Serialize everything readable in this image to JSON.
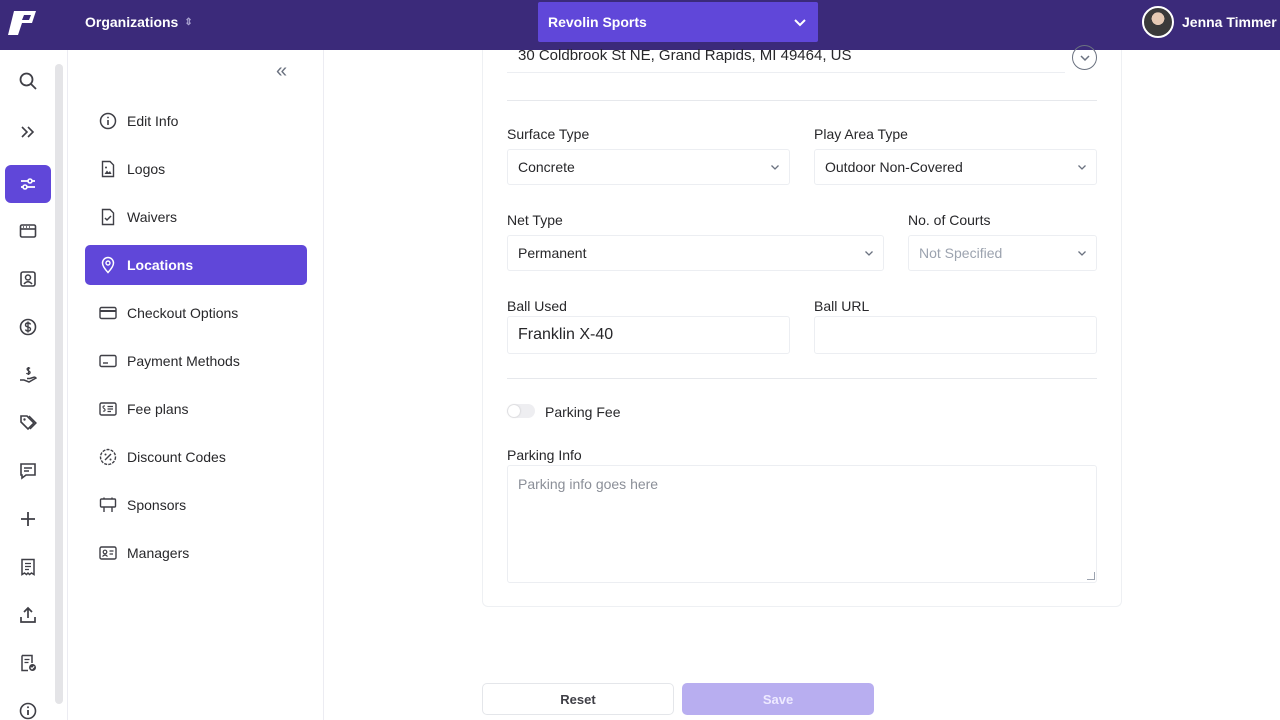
{
  "topbar": {
    "org_label": "Organizations",
    "org_selected": "Revolin Sports",
    "user_name": "Jenna Timmer",
    "colors": {
      "bg": "#3b2a7a",
      "accent": "#6047d9"
    }
  },
  "rail": {
    "icons": [
      "search-icon",
      "expand-icon",
      "settings-sliders-icon",
      "calendar-card-icon",
      "contact-icon",
      "dollar-icon",
      "payout-hand-icon",
      "tags-icon",
      "chat-icon",
      "plus-icon",
      "receipt-icon",
      "upload-icon",
      "checklist-icon",
      "info-icon"
    ]
  },
  "sidebar": {
    "items": [
      {
        "label": "Edit Info",
        "icon": "info-icon"
      },
      {
        "label": "Logos",
        "icon": "image-file-icon"
      },
      {
        "label": "Waivers",
        "icon": "file-check-icon"
      },
      {
        "label": "Locations",
        "icon": "map-pin-icon",
        "active": true
      },
      {
        "label": "Checkout Options",
        "icon": "credit-card-icon"
      },
      {
        "label": "Payment Methods",
        "icon": "payment-card-icon"
      },
      {
        "label": "Fee plans",
        "icon": "fee-list-icon"
      },
      {
        "label": "Discount Codes",
        "icon": "discount-icon"
      },
      {
        "label": "Sponsors",
        "icon": "billboard-icon"
      },
      {
        "label": "Managers",
        "icon": "id-card-icon"
      }
    ]
  },
  "form": {
    "address": "30 Coldbrook St NE, Grand Rapids, MI 49464, US",
    "surface_type": {
      "label": "Surface Type",
      "value": "Concrete"
    },
    "play_area_type": {
      "label": "Play Area Type",
      "value": "Outdoor Non-Covered"
    },
    "net_type": {
      "label": "Net Type",
      "value": "Permanent"
    },
    "num_courts": {
      "label": "No. of Courts",
      "value": "Not Specified"
    },
    "ball_used": {
      "label": "Ball Used",
      "value": "Franklin X-40"
    },
    "ball_url": {
      "label": "Ball URL",
      "value": ""
    },
    "parking_fee": {
      "label": "Parking Fee",
      "enabled": false
    },
    "parking_info": {
      "label": "Parking Info",
      "placeholder": "Parking info goes here"
    }
  },
  "actions": {
    "reset": "Reset",
    "save": "Save"
  }
}
